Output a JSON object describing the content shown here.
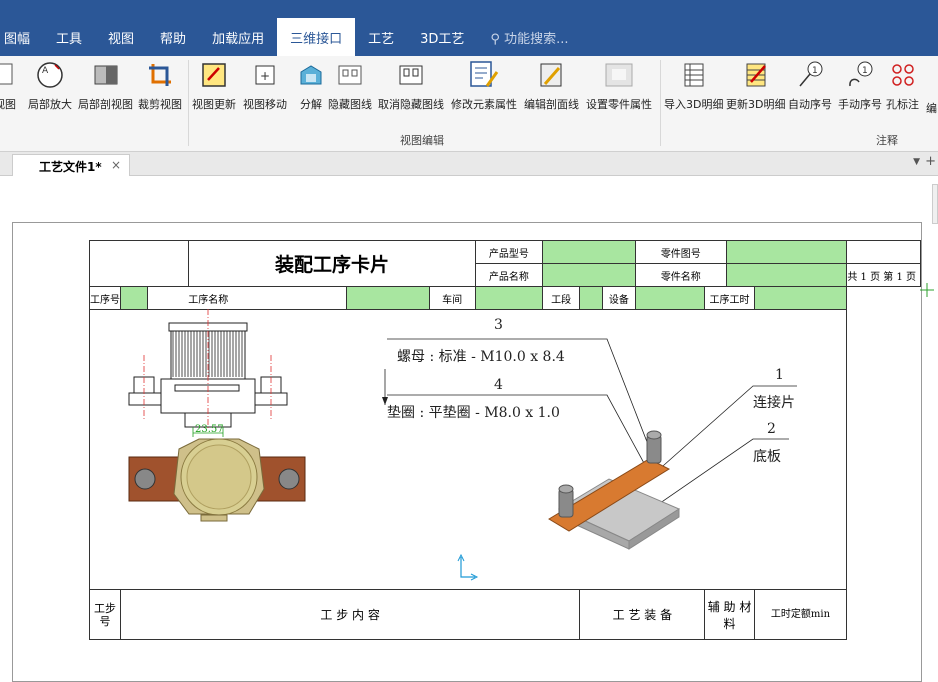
{
  "menu": {
    "items": [
      "图幅",
      "工具",
      "视图",
      "帮助",
      "加载应用",
      "三维接口",
      "工艺",
      "3D工艺",
      "功能搜索..."
    ],
    "active_index": 5
  },
  "ribbon": {
    "tools": [
      "视图",
      "局部放大",
      "局部剖视图",
      "裁剪视图",
      "视图更新",
      "视图移动",
      "分解",
      "隐藏图线",
      "取消隐藏图线",
      "修改元素属性",
      "编辑剖面线",
      "设置零件属性",
      "导入3D明细",
      "更新3D明细",
      "自动序号",
      "手动序号",
      "孔标注",
      "编"
    ],
    "groups": {
      "view_edit": "视图编辑",
      "annotation": "注释"
    }
  },
  "tab": {
    "label": "工艺文件1*",
    "close": "×"
  },
  "card": {
    "title": "装配工序卡片",
    "product_model": "产品型号",
    "product_name": "产品名称",
    "part_no": "零件图号",
    "part_name": "零件名称",
    "total": "共",
    "total_num": "1",
    "page": "页",
    "nth": "第",
    "nth_num": "1",
    "proc_no": "工序号",
    "proc_name": "工序名称",
    "workshop": "车间",
    "section": "工段",
    "equipment": "设备",
    "proc_time": "工序工时",
    "step_no": "工步号",
    "step_content": "工 步 内 容",
    "process_equip": "工 艺 装 备",
    "aux_material": "辅 助 材 料",
    "time_quota": "工时定额min"
  },
  "drawing": {
    "dim": "23.57",
    "b3_num": "3",
    "b3_text": "螺母 : 标准 - M10.0 x 8.4",
    "b4_num": "4",
    "b4_text": "垫圈 : 平垫圈 - M8.0 x 1.0",
    "b1_num": "1",
    "b1_text": "连接片",
    "b2_num": "2",
    "b2_text": "底板"
  }
}
